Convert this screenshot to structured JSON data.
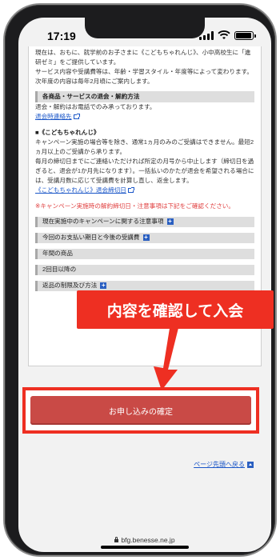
{
  "status": {
    "time": "17:19"
  },
  "content": {
    "intro1": "現在は、おもに、就学前のお子さまに《こどもちゃれんじ》、小中高校生に「進研ゼミ」をご提供しています。",
    "intro2": "サービス内容や受講費等は、年齢・学習スタイル・年度等によって変わります。次年度の内容は毎年2月頃にご案内します。",
    "cancel_heading": "各商品・サービスの退会・解約方法",
    "cancel_text": "退会・解約はお電話でのみ承っております。",
    "cancel_link": "退会時連絡先",
    "kodomo_title": "■《こどもちゃれんじ》",
    "kodomo_p1": "キャンペーン実施の場合等を除き、通常1ヵ月のみのご受講はできません。最短2ヵ月以上のご受講から承ります。",
    "kodomo_p2": "毎月の締切日までにご連絡いただければ所定の月号から中止します（締切日を過ぎると、退会が1か月先になります）。一括払いのかたが退会を希望される場合には、受講月数に応じて受講費を計算し直し、返金します。",
    "kodomo_link": "《こどもちゃれんじ》退会締切日",
    "red_note": "※キャンペーン実施時の解約締切日・注意事項は下記をご確認ください。",
    "expand_items": [
      "現在実施中のキャンペーンに関する注意事項",
      "今回のお支払い期日と今後の受講費",
      "年間の商品",
      "2回目以降の",
      "返品の制限及び方法"
    ]
  },
  "callout_text": "内容を確認して入会",
  "confirm_button": "お申し込みの確定",
  "page_top_link": "ページ先頭へ戻る",
  "url": "bfg.benesse.ne.jp",
  "colors": {
    "accent_red": "#ee2f22",
    "button_red": "#c94a46",
    "link_blue": "#1a56c8"
  }
}
